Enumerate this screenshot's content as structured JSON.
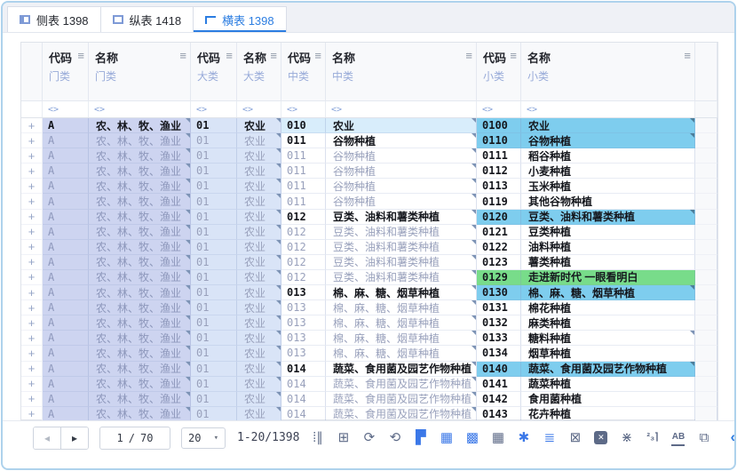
{
  "colors": {
    "accent_blue": "#2b7de1",
    "cyan_highlight": "#7ecdee",
    "green_highlight": "#78dc8a",
    "periwinkle": "#cdd4f0",
    "light_blue_l2": "#d9e4f7",
    "mid_tint": "#d8edfb"
  },
  "tabs": [
    {
      "label": "侧表",
      "count": "1398",
      "icon": "side-table-icon",
      "active": false
    },
    {
      "label": "纵表",
      "count": "1418",
      "icon": "vertical-table-icon",
      "active": false
    },
    {
      "label": "横表",
      "count": "1398",
      "icon": "horizontal-table-icon",
      "active": true
    }
  ],
  "table": {
    "menu_glyph": "≡",
    "filter_glyph": "<>",
    "expand_glyph": "+",
    "columns": [
      {
        "title": "代码",
        "level": "门类"
      },
      {
        "title": "名称",
        "level": "门类"
      },
      {
        "title": "代码",
        "level": "大类"
      },
      {
        "title": "名称",
        "level": "大类"
      },
      {
        "title": "代码",
        "level": "中类"
      },
      {
        "title": "名称",
        "level": "中类"
      },
      {
        "title": "代码",
        "level": "小类"
      },
      {
        "title": "名称",
        "level": "小类"
      }
    ],
    "rows": [
      {
        "c": [
          "A",
          "农、林、牧、渔业",
          "01",
          "农业",
          "010",
          "农业",
          "0100",
          "农业"
        ],
        "bold": [
          1,
          1,
          1,
          1,
          1,
          1,
          1,
          1
        ],
        "hl": "cyan",
        "tint": true,
        "xtri": true
      },
      {
        "c": [
          "A",
          "农、林、牧、渔业",
          "01",
          "农业",
          "011",
          "谷物种植",
          "0110",
          "谷物种植"
        ],
        "bold": [
          0,
          0,
          0,
          0,
          1,
          1,
          1,
          1
        ],
        "hl": "cyan",
        "tint": false,
        "xtri": true
      },
      {
        "c": [
          "A",
          "农、林、牧、渔业",
          "01",
          "农业",
          "011",
          "谷物种植",
          "0111",
          "稻谷种植"
        ],
        "bold": [
          0,
          0,
          0,
          0,
          0,
          0,
          1,
          1
        ],
        "hl": "none",
        "tint": false,
        "xtri": false
      },
      {
        "c": [
          "A",
          "农、林、牧、渔业",
          "01",
          "农业",
          "011",
          "谷物种植",
          "0112",
          "小麦种植"
        ],
        "bold": [
          0,
          0,
          0,
          0,
          0,
          0,
          1,
          1
        ],
        "hl": "none",
        "tint": false,
        "xtri": false
      },
      {
        "c": [
          "A",
          "农、林、牧、渔业",
          "01",
          "农业",
          "011",
          "谷物种植",
          "0113",
          "玉米种植"
        ],
        "bold": [
          0,
          0,
          0,
          0,
          0,
          0,
          1,
          1
        ],
        "hl": "none",
        "tint": false,
        "xtri": false
      },
      {
        "c": [
          "A",
          "农、林、牧、渔业",
          "01",
          "农业",
          "011",
          "谷物种植",
          "0119",
          "其他谷物种植"
        ],
        "bold": [
          0,
          0,
          0,
          0,
          0,
          0,
          1,
          1
        ],
        "hl": "none",
        "tint": false,
        "xtri": false
      },
      {
        "c": [
          "A",
          "农、林、牧、渔业",
          "01",
          "农业",
          "012",
          "豆类、油料和薯类种植",
          "0120",
          "豆类、油料和薯类种植"
        ],
        "bold": [
          0,
          0,
          0,
          0,
          1,
          1,
          1,
          1
        ],
        "hl": "cyan",
        "tint": false,
        "xtri": true
      },
      {
        "c": [
          "A",
          "农、林、牧、渔业",
          "01",
          "农业",
          "012",
          "豆类、油料和薯类种植",
          "0121",
          "豆类种植"
        ],
        "bold": [
          0,
          0,
          0,
          0,
          0,
          0,
          1,
          1
        ],
        "hl": "none",
        "tint": false,
        "xtri": false
      },
      {
        "c": [
          "A",
          "农、林、牧、渔业",
          "01",
          "农业",
          "012",
          "豆类、油料和薯类种植",
          "0122",
          "油料种植"
        ],
        "bold": [
          0,
          0,
          0,
          0,
          0,
          0,
          1,
          1
        ],
        "hl": "none",
        "tint": false,
        "xtri": false
      },
      {
        "c": [
          "A",
          "农、林、牧、渔业",
          "01",
          "农业",
          "012",
          "豆类、油料和薯类种植",
          "0123",
          "薯类种植"
        ],
        "bold": [
          0,
          0,
          0,
          0,
          0,
          0,
          1,
          1
        ],
        "hl": "none",
        "tint": false,
        "xtri": false
      },
      {
        "c": [
          "A",
          "农、林、牧、渔业",
          "01",
          "农业",
          "012",
          "豆类、油料和薯类种植",
          "0129",
          "走进新时代 一眼看明白"
        ],
        "bold": [
          0,
          0,
          0,
          0,
          0,
          0,
          1,
          1
        ],
        "hl": "green",
        "tint": false,
        "xtri": false
      },
      {
        "c": [
          "A",
          "农、林、牧、渔业",
          "01",
          "农业",
          "013",
          "棉、麻、糖、烟草种植",
          "0130",
          "棉、麻、糖、烟草种植"
        ],
        "bold": [
          0,
          0,
          0,
          0,
          1,
          1,
          1,
          1
        ],
        "hl": "cyan",
        "tint": false,
        "xtri": true
      },
      {
        "c": [
          "A",
          "农、林、牧、渔业",
          "01",
          "农业",
          "013",
          "棉、麻、糖、烟草种植",
          "0131",
          "棉花种植"
        ],
        "bold": [
          0,
          0,
          0,
          0,
          0,
          0,
          1,
          1
        ],
        "hl": "none",
        "tint": false,
        "xtri": false
      },
      {
        "c": [
          "A",
          "农、林、牧、渔业",
          "01",
          "农业",
          "013",
          "棉、麻、糖、烟草种植",
          "0132",
          "麻类种植"
        ],
        "bold": [
          0,
          0,
          0,
          0,
          0,
          0,
          1,
          1
        ],
        "hl": "none",
        "tint": false,
        "xtri": false
      },
      {
        "c": [
          "A",
          "农、林、牧、渔业",
          "01",
          "农业",
          "013",
          "棉、麻、糖、烟草种植",
          "0133",
          "糖料种植"
        ],
        "bold": [
          0,
          0,
          0,
          0,
          0,
          0,
          1,
          1
        ],
        "hl": "none",
        "tint": false,
        "xtri": true
      },
      {
        "c": [
          "A",
          "农、林、牧、渔业",
          "01",
          "农业",
          "013",
          "棉、麻、糖、烟草种植",
          "0134",
          "烟草种植"
        ],
        "bold": [
          0,
          0,
          0,
          0,
          0,
          0,
          1,
          1
        ],
        "hl": "none",
        "tint": false,
        "xtri": false
      },
      {
        "c": [
          "A",
          "农、林、牧、渔业",
          "01",
          "农业",
          "014",
          "蔬菜、食用菌及园艺作物种植",
          "0140",
          "蔬菜、食用菌及园艺作物种植"
        ],
        "bold": [
          0,
          0,
          0,
          0,
          1,
          1,
          1,
          1
        ],
        "hl": "cyan",
        "tint": false,
        "xtri": true
      },
      {
        "c": [
          "A",
          "农、林、牧、渔业",
          "01",
          "农业",
          "014",
          "蔬菜、食用菌及园艺作物种植",
          "0141",
          "蔬菜种植"
        ],
        "bold": [
          0,
          0,
          0,
          0,
          0,
          0,
          1,
          1
        ],
        "hl": "none",
        "tint": false,
        "xtri": false
      },
      {
        "c": [
          "A",
          "农、林、牧、渔业",
          "01",
          "农业",
          "014",
          "蔬菜、食用菌及园艺作物种植",
          "0142",
          "食用菌种植"
        ],
        "bold": [
          0,
          0,
          0,
          0,
          0,
          0,
          1,
          1
        ],
        "hl": "none",
        "tint": false,
        "xtri": false
      },
      {
        "c": [
          "A",
          "农、林、牧、渔业",
          "01",
          "农业",
          "014",
          "蔬菜、食用菌及园艺作物种植",
          "0143",
          "花卉种植"
        ],
        "bold": [
          0,
          0,
          0,
          0,
          0,
          0,
          1,
          1
        ],
        "hl": "none",
        "tint": false,
        "xtri": false
      }
    ]
  },
  "pagination": {
    "prev": "◂",
    "next": "▸",
    "page": "1",
    "sep": "/",
    "total": "70",
    "size": "20",
    "caret": "▾",
    "range": "1-20/1398"
  },
  "toolbar_icons": [
    {
      "name": "unfold-columns-icon",
      "glyph": "⁞∥",
      "tone": "gray"
    },
    {
      "name": "add-table-icon",
      "glyph": "⊞",
      "tone": "gray"
    },
    {
      "name": "refresh-icon",
      "glyph": "⟳",
      "tone": "gray"
    },
    {
      "name": "sync-icon",
      "glyph": "⟲",
      "tone": "gray"
    },
    {
      "name": "layout-table-icon",
      "glyph": "▛",
      "tone": "blue"
    },
    {
      "name": "grid-dark-icon",
      "glyph": "▦",
      "tone": "blue"
    },
    {
      "name": "grid-pattern-icon",
      "glyph": "▩",
      "tone": "blue"
    },
    {
      "name": "table-grid-icon",
      "glyph": "▦",
      "tone": "gray"
    },
    {
      "name": "asterisk-icon",
      "glyph": "✱",
      "tone": "blue"
    },
    {
      "name": "list-settings-icon",
      "glyph": "≣",
      "tone": "blue"
    },
    {
      "name": "excel-export-icon",
      "glyph": "⊠",
      "tone": "gray"
    },
    {
      "name": "close-square-icon",
      "glyph": "✕",
      "tone": "chip"
    },
    {
      "name": "dotted-cross-icon",
      "glyph": "⋇",
      "tone": "gray"
    },
    {
      "name": "sort-numeric-icon",
      "glyph": "²₃⌉",
      "tone": "gray small"
    },
    {
      "name": "sort-alpha-icon",
      "glyph": "AB",
      "tone": "gray underline"
    },
    {
      "name": "copy-layers-icon",
      "glyph": "⧉",
      "tone": "gray"
    }
  ],
  "edge_chevron": {
    "name": "edge-chevron-icon",
    "glyph": "«"
  }
}
